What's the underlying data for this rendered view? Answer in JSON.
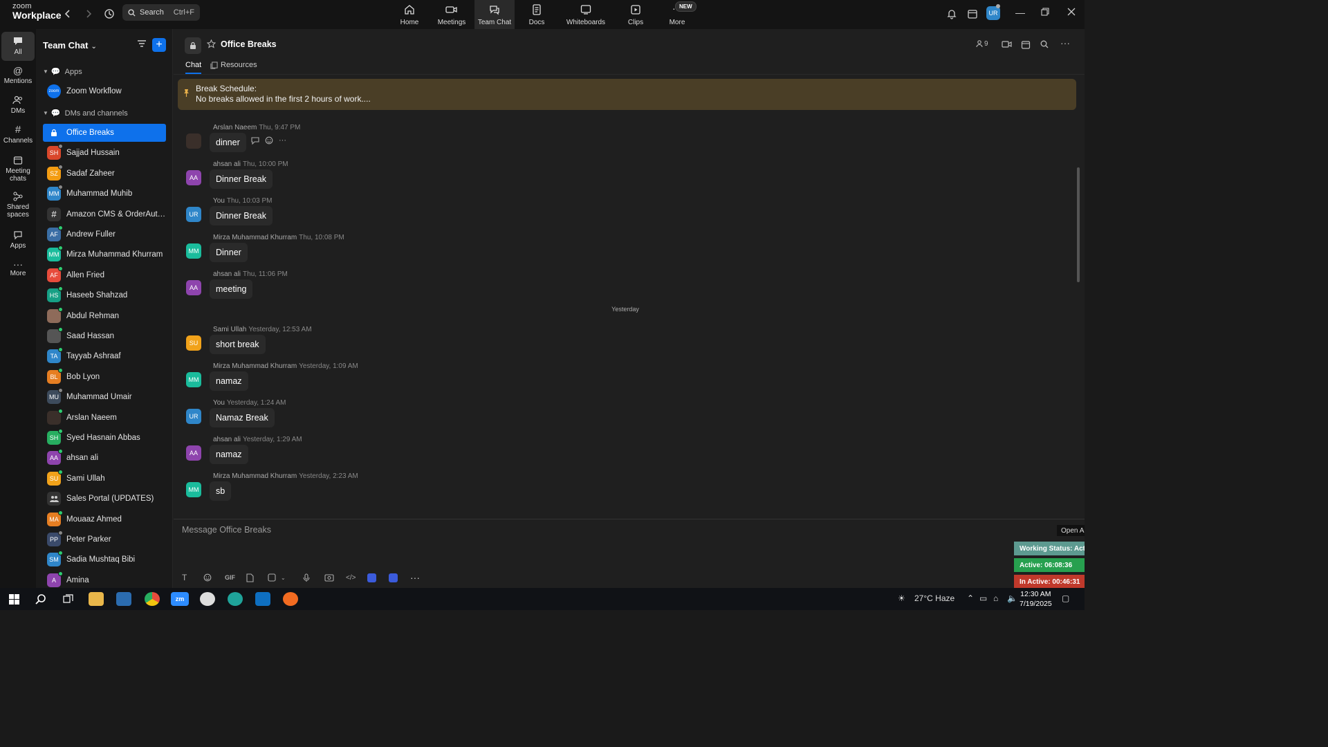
{
  "app": {
    "brand_small": "zoom",
    "brand_large": "Workplace",
    "search_label": "Search",
    "search_shortcut": "Ctrl+F",
    "nav": [
      {
        "label": "Home",
        "icon": "home-icon"
      },
      {
        "label": "Meetings",
        "icon": "video-icon"
      },
      {
        "label": "Team Chat",
        "icon": "chat-icon"
      },
      {
        "label": "Docs",
        "icon": "document-icon"
      },
      {
        "label": "Whiteboards",
        "icon": "whiteboard-icon"
      },
      {
        "label": "Clips",
        "icon": "clips-icon"
      },
      {
        "label": "More",
        "icon": "more-icon"
      }
    ],
    "new_badge": "NEW",
    "user_initials": "UR"
  },
  "rail": [
    {
      "label": "All",
      "icon": "chat-bubble-icon"
    },
    {
      "label": "Mentions",
      "icon": "at-icon"
    },
    {
      "label": "DMs",
      "icon": "people-icon"
    },
    {
      "label": "Channels",
      "icon": "hash-icon"
    },
    {
      "label": "Meeting chats",
      "icon": "calendar-icon"
    },
    {
      "label": "Shared spaces",
      "icon": "share-icon"
    },
    {
      "label": "Apps",
      "icon": "apps-icon"
    },
    {
      "label": "More",
      "icon": "ellipsis-icon"
    }
  ],
  "sidebar": {
    "title": "Team Chat",
    "sections": {
      "apps": "Apps",
      "dms": "DMs and channels"
    },
    "apps": [
      {
        "name": "Zoom Workflow",
        "initials": "zoom",
        "color": "#0e71eb"
      }
    ],
    "items": [
      {
        "name": "Office Breaks",
        "initials": "",
        "color": "#0e71eb",
        "kind": "lock",
        "status": ""
      },
      {
        "name": "Sajjad Hussain",
        "initials": "SH",
        "color": "#d9472b",
        "status": "#888888"
      },
      {
        "name": "Sadaf Zaheer",
        "initials": "SZ",
        "color": "#f39c12",
        "status": "#888888"
      },
      {
        "name": "Muhammad Muhib",
        "initials": "MM",
        "color": "#2f86c9",
        "status": "#888888"
      },
      {
        "name": "Amazon CMS & OrderAuto...",
        "initials": "#",
        "color": "#333333",
        "kind": "hash",
        "status": ""
      },
      {
        "name": "Andrew Fuller",
        "initials": "AF",
        "color": "#3a6ea5",
        "status": "#2ecc71"
      },
      {
        "name": "Mirza Muhammad Khurram",
        "initials": "MM",
        "color": "#1abc9c",
        "status": "#2ecc71"
      },
      {
        "name": "Allen Fried",
        "initials": "AF",
        "color": "#e74c3c",
        "status": "#2ecc71"
      },
      {
        "name": "Haseeb Shahzad",
        "initials": "HS",
        "color": "#16a085",
        "status": "#2ecc71"
      },
      {
        "name": "Abdul Rehman",
        "initials": "",
        "color": "#8e6b5a",
        "status": "#2ecc71"
      },
      {
        "name": "Saad Hassan",
        "initials": "",
        "color": "#555555",
        "status": "#2ecc71"
      },
      {
        "name": "Tayyab Ashraaf",
        "initials": "TA",
        "color": "#2f86c9",
        "status": "#2ecc71"
      },
      {
        "name": "Bob Lyon",
        "initials": "BL",
        "color": "#e67e22",
        "status": "#2ecc71"
      },
      {
        "name": "Muhammad Umair",
        "initials": "MU",
        "color": "#3d4b5c",
        "status": "#888888"
      },
      {
        "name": "Arslan Naeem",
        "initials": "",
        "color": "#3a2f2a",
        "status": "#2ecc71"
      },
      {
        "name": "Syed Hasnain Abbas",
        "initials": "SH",
        "color": "#27ae60",
        "status": "#2ecc71"
      },
      {
        "name": "ahsan ali",
        "initials": "AA",
        "color": "#8e44ad",
        "status": "#2ecc71"
      },
      {
        "name": "Sami Ullah",
        "initials": "SU",
        "color": "#f1a21a",
        "status": "#2ecc71"
      },
      {
        "name": "Sales Portal (UPDATES)",
        "initials": "",
        "color": "#333333",
        "kind": "group",
        "status": ""
      },
      {
        "name": "Mouaaz Ahmed",
        "initials": "MA",
        "color": "#e67e22",
        "status": "#2ecc71"
      },
      {
        "name": "Peter Parker",
        "initials": "PP",
        "color": "#3a4a6a",
        "status": "#888888"
      },
      {
        "name": "Sadia Mushtaq Bibi",
        "initials": "SM",
        "color": "#2f86c9",
        "status": "#2ecc71"
      },
      {
        "name": "Amina",
        "initials": "A",
        "color": "#8e44ad",
        "status": "#2ecc71"
      }
    ]
  },
  "chat": {
    "title": "Office Breaks",
    "tabs": [
      "Chat",
      "Resources"
    ],
    "member_count": "9",
    "pinned_title": "Break Schedule:",
    "pinned_text": "No breaks allowed in the first 2 hours of work....",
    "date_divider": "Yesterday",
    "messages": [
      {
        "sender": "Arslan Naeem",
        "time": "Thu, 9:47 PM",
        "text": "dinner",
        "initials": "",
        "color": "#3a2f2a"
      },
      {
        "sender": "ahsan ali",
        "time": "Thu, 10:00 PM",
        "text": "Dinner Break",
        "initials": "AA",
        "color": "#8e44ad"
      },
      {
        "sender": "You",
        "time": "Thu, 10:03 PM",
        "text": "Dinner Break",
        "initials": "UR",
        "color": "#2f86c9"
      },
      {
        "sender": "Mirza Muhammad Khurram",
        "time": "Thu, 10:08 PM",
        "text": "Dinner",
        "initials": "MM",
        "color": "#1abc9c"
      },
      {
        "sender": "ahsan ali",
        "time": "Thu, 11:06 PM",
        "text": "meeting",
        "initials": "AA",
        "color": "#8e44ad"
      },
      {
        "sender": "Sami Ullah",
        "time": "Yesterday, 12:53 AM",
        "text": "short break",
        "initials": "SU",
        "color": "#f1a21a"
      },
      {
        "sender": "Mirza Muhammad Khurram",
        "time": "Yesterday, 1:09 AM",
        "text": "namaz",
        "initials": "MM",
        "color": "#1abc9c"
      },
      {
        "sender": "You",
        "time": "Yesterday, 1:24 AM",
        "text": "Namaz Break",
        "initials": "UR",
        "color": "#2f86c9"
      },
      {
        "sender": "ahsan ali",
        "time": "Yesterday, 1:29 AM",
        "text": "namaz",
        "initials": "AA",
        "color": "#8e44ad"
      },
      {
        "sender": "Mirza Muhammad Khurram",
        "time": "Yesterday, 2:23 AM",
        "text": "sb",
        "initials": "MM",
        "color": "#1abc9c"
      }
    ],
    "composer_placeholder": "Message Office Breaks"
  },
  "status_widget": {
    "open_label": "Open A",
    "working": "Working Status: Acti",
    "active": "Active: 06:08:36",
    "inactive": "In Active: 00:46:31",
    "colors": {
      "working": "#5d9a90",
      "active": "#27a04f",
      "inactive": "#c0392b"
    }
  },
  "taskbar": {
    "weather": "27°C  Haze",
    "time": "12:30 AM",
    "date": "7/19/2025"
  }
}
